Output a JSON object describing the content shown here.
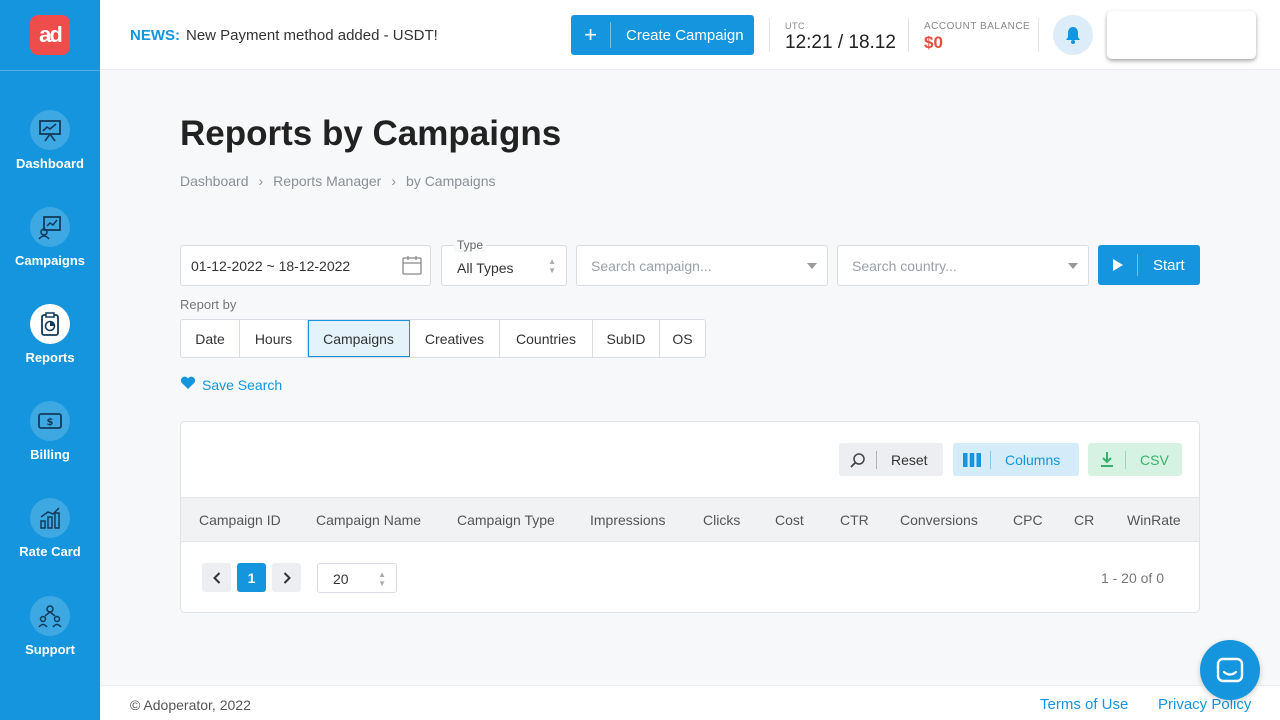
{
  "brand": {
    "logo_text": "ad",
    "logo_color": "#ef4c4c",
    "accent": "#1495dd"
  },
  "sidebar": {
    "items": [
      {
        "label": "Dashboard",
        "icon": "presentation-chart-icon"
      },
      {
        "label": "Campaigns",
        "icon": "campaign-chart-icon"
      },
      {
        "label": "Reports",
        "icon": "clipboard-report-icon",
        "active": true
      },
      {
        "label": "Billing",
        "icon": "dollar-bill-icon"
      },
      {
        "label": "Rate Card",
        "icon": "bar-chart-icon"
      },
      {
        "label": "Support",
        "icon": "team-support-icon"
      }
    ]
  },
  "header": {
    "news_tag": "NEWS:",
    "news_text": "New Payment method added - USDT!",
    "create_button": "Create Campaign",
    "utc_label": "UTC",
    "utc_value": "12:21 / 18.12",
    "balance_label": "ACCOUNT BALANCE",
    "balance_value": "$0"
  },
  "page": {
    "title": "Reports by Campaigns",
    "breadcrumb": [
      "Dashboard",
      "Reports Manager",
      "by Campaigns"
    ],
    "breadcrumb_sep": "›"
  },
  "filters": {
    "date_range": "01-12-2022 ~ 18-12-2022",
    "type_legend": "Type",
    "type_value": "All Types",
    "campaign_placeholder": "Search campaign...",
    "country_placeholder": "Search country...",
    "start_button": "Start"
  },
  "report_by": {
    "label": "Report by",
    "options": [
      "Date",
      "Hours",
      "Campaigns",
      "Creatives",
      "Countries",
      "SubID",
      "OS"
    ],
    "selected": "Campaigns"
  },
  "save_search": "Save Search",
  "toolbar": {
    "reset": "Reset",
    "columns": "Columns",
    "csv": "CSV"
  },
  "table": {
    "columns": [
      "Campaign ID",
      "Campaign Name",
      "Campaign Type",
      "Impressions",
      "Clicks",
      "Cost",
      "CTR",
      "Conversions",
      "CPC",
      "CR",
      "WinRate"
    ],
    "rows": []
  },
  "pagination": {
    "current_page": "1",
    "page_size": "20",
    "info": "1 - 20 of 0"
  },
  "footer": {
    "copyright": "© Adoperator, 2022",
    "terms": "Terms of Use",
    "privacy": "Privacy Policy"
  }
}
